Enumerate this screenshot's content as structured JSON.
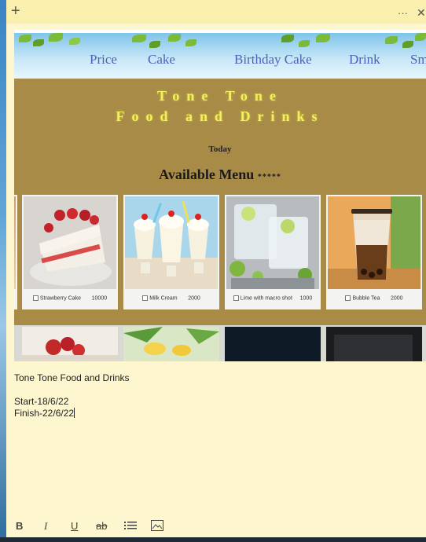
{
  "titlebar": {
    "add_symbol": "+",
    "more_symbol": "···",
    "close_symbol": "✕"
  },
  "nav": {
    "items": [
      "Price",
      "Cake",
      "Birthday Cake",
      "Drink",
      "Sm"
    ]
  },
  "banner": {
    "brand_line1": "Tone Tone",
    "brand_line2": "Food and Drinks",
    "today": "Today",
    "available": "Available Menu",
    "stars": "*****"
  },
  "menu": {
    "items": [
      {
        "name": "Strawberry Cake",
        "price": "10000"
      },
      {
        "name": "Milk Cream",
        "price": "2000"
      },
      {
        "name": "Lime with macro shot",
        "price": "1000"
      },
      {
        "name": "Bubble Tea",
        "price": "2000"
      }
    ]
  },
  "note": {
    "line1": "Tone Tone Food and Drinks",
    "line2": "Start-18/6/22",
    "line3": "Finish-22/6/22"
  },
  "toolbar": {
    "bold": "B",
    "italic": "I",
    "underline": "U",
    "strike": "ab"
  },
  "colors": {
    "note_bg": "#fdf6cf",
    "titlebar": "#fbefae",
    "brown": "#a88b47",
    "brand_text": "#f4f05c",
    "nav_text": "#4a62b8"
  }
}
